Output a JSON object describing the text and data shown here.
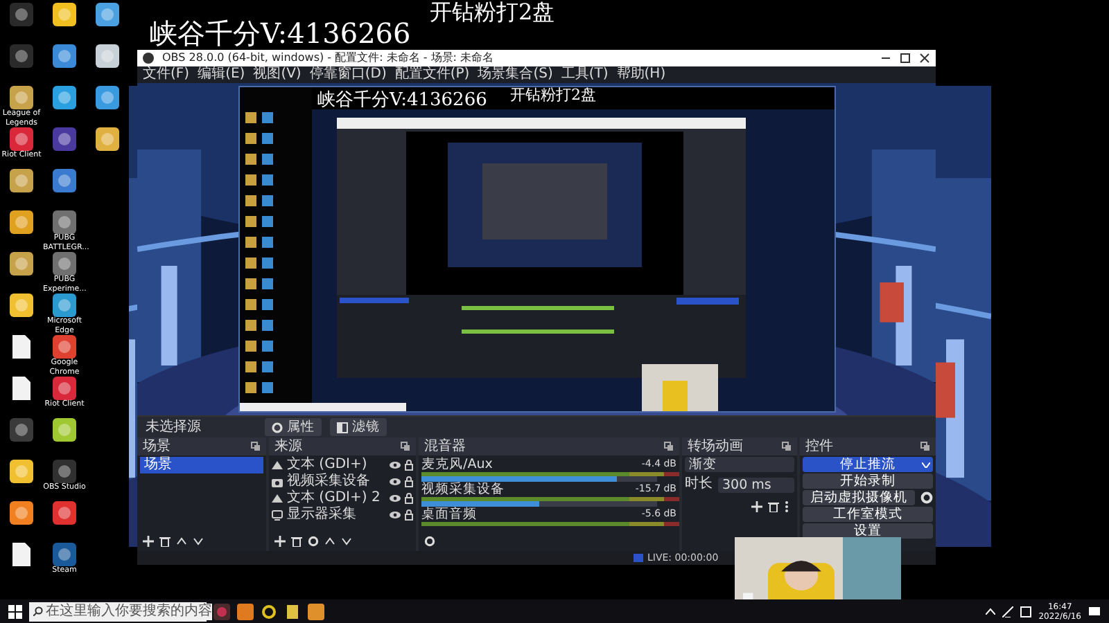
{
  "stream_overlay": {
    "topic": "开钻粉打2盘",
    "contact": "峡谷千分V:4136266"
  },
  "desktop_icons": [
    [
      {
        "kind": "tile",
        "color": "#2a2a2a"
      },
      {
        "kind": "tile",
        "color": "#2a2a2a"
      },
      {
        "kind": "tile",
        "color": "#c8a24a",
        "label": "League of Legends"
      },
      {
        "kind": "tile",
        "color": "#d8283a",
        "label": "Riot Client"
      },
      {
        "kind": "tile",
        "color": "#c8a24a"
      },
      {
        "kind": "tile",
        "color": "#e0a020"
      },
      {
        "kind": "tile",
        "color": "#c8a24a"
      },
      {
        "kind": "tile",
        "color": "#f0c030"
      },
      {
        "kind": "doc",
        "color": "#f2f2f2"
      },
      {
        "kind": "doc",
        "color": "#f2f2f2"
      },
      {
        "kind": "tile",
        "color": "#3a3a3a"
      },
      {
        "kind": "tile",
        "color": "#f0c030"
      },
      {
        "kind": "tile",
        "color": "#f08020"
      },
      {
        "kind": "doc",
        "color": "#f2f2f2"
      }
    ],
    [
      {
        "kind": "tile",
        "color": "#f0c020"
      },
      {
        "kind": "tile",
        "color": "#3a8ad8"
      },
      {
        "kind": "tile",
        "color": "#2aa0e0"
      },
      {
        "kind": "tile",
        "color": "#4a3aa0"
      },
      {
        "kind": "tile",
        "color": "#3a7ad0"
      },
      {
        "kind": "tile",
        "color": "#707070",
        "label": "PUBG BATTLEGR..."
      },
      {
        "kind": "tile",
        "color": "#707070",
        "label": "PUBG Experime..."
      },
      {
        "kind": "tile",
        "color": "#2a9ad0",
        "label": "Microsoft Edge"
      },
      {
        "kind": "tile",
        "color": "#e04030",
        "label": "Google Chrome"
      },
      {
        "kind": "tile",
        "color": "#d8283a",
        "label": "Riot Client"
      },
      {
        "kind": "tile",
        "color": "#a0c830"
      },
      {
        "kind": "tile",
        "color": "#303030",
        "label": "OBS Studio"
      },
      {
        "kind": "tile",
        "color": "#e03030"
      },
      {
        "kind": "tile",
        "color": "#1a5a9a",
        "label": "Steam"
      }
    ],
    [
      {
        "kind": "tile",
        "color": "#4aa0e0"
      },
      {
        "kind": "tile",
        "color": "#c8d0d8"
      },
      {
        "kind": "tile",
        "color": "#3a9ae0"
      },
      {
        "kind": "tile",
        "color": "#e0b040"
      }
    ]
  ],
  "obs": {
    "title": "OBS 28.0.0 (64-bit, windows) - 配置文件: 未命名 - 场景: 未命名",
    "menu": [
      "文件(F)",
      "编辑(E)",
      "视图(V)",
      "停靠窗口(D)",
      "配置文件(P)",
      "场景集合(S)",
      "工具(T)",
      "帮助(H)"
    ],
    "preview": {
      "topic": "开钻粉打2盘",
      "contact": "峡谷千分V:4136266"
    },
    "source_toolbar": {
      "label": "未选择源",
      "buttons": [
        {
          "label": "属性",
          "kind": "gear"
        },
        {
          "label": "滤镜",
          "kind": "filter"
        }
      ]
    },
    "scenes": {
      "title": "场景",
      "items": [
        {
          "label": "场景",
          "selected": true
        }
      ]
    },
    "sources": {
      "title": "来源",
      "items": [
        {
          "label": "文本 (GDI+)",
          "kind": "text",
          "visible": true
        },
        {
          "label": "视频采集设备",
          "kind": "camera",
          "visible": true
        },
        {
          "label": "文本 (GDI+) 2",
          "kind": "text",
          "visible": true
        },
        {
          "label": "显示器采集",
          "kind": "monitor",
          "visible": true
        }
      ]
    },
    "mixer": {
      "title": "混音器",
      "channels": [
        {
          "name": "麦克风/Aux",
          "reading": "-4.4 dB",
          "level": 0.83
        },
        {
          "name": "视频采集设备",
          "reading": "-15.7 dB",
          "level": 0.5
        },
        {
          "name": "桌面音频",
          "reading": "-5.6 dB"
        }
      ]
    },
    "transitions": {
      "title": "转场动画",
      "type": "渐变",
      "duration_label": "时长",
      "duration": "300 ms"
    },
    "controls": {
      "title": "控件",
      "buttons": [
        {
          "label": "停止推流",
          "active": true
        },
        {
          "label": "开始录制",
          "active": false
        },
        {
          "label": "启动虚拟摄像机",
          "active": false,
          "kind": "with-gear"
        },
        {
          "label": "工作室模式",
          "active": false
        },
        {
          "label": "设置",
          "active": false
        }
      ]
    },
    "status": {
      "live": "LIVE: 00:00:00"
    }
  },
  "taskbar": {
    "search_placeholder": "在这里输入你要搜索的内容",
    "time": "16:47",
    "date": "2022/6/16"
  }
}
